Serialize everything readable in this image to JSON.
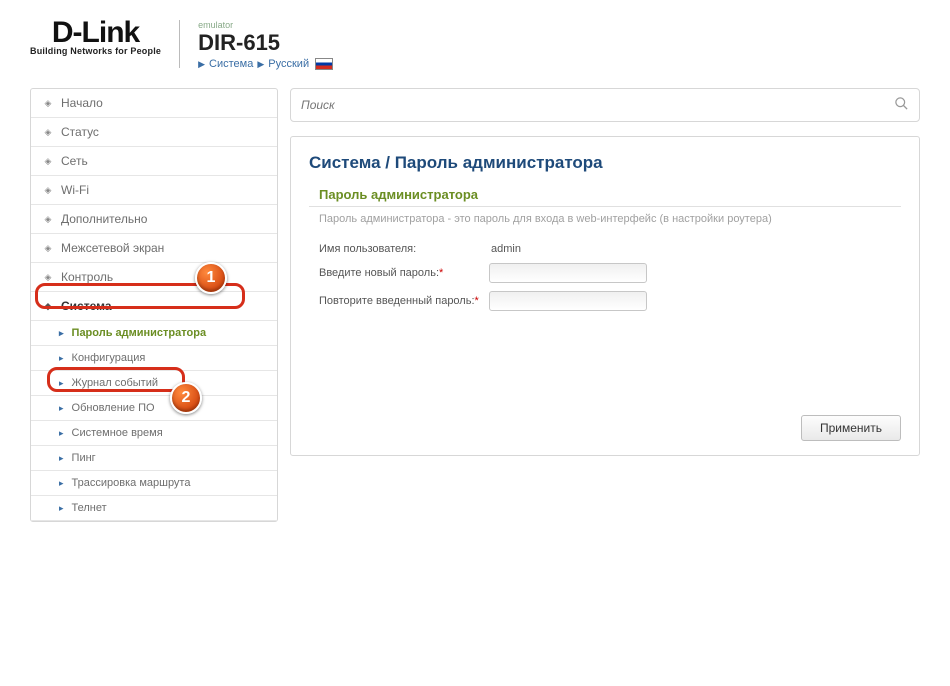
{
  "header": {
    "logo_text": "D-Link",
    "logo_sub": "Building Networks for People",
    "emulator": "emulator",
    "model": "DIR-615",
    "crumb1": "Система",
    "crumb2": "Русский"
  },
  "sidebar": {
    "items": [
      {
        "label": "Начало"
      },
      {
        "label": "Статус"
      },
      {
        "label": "Сеть"
      },
      {
        "label": "Wi-Fi"
      },
      {
        "label": "Дополнительно"
      },
      {
        "label": "Межсетевой экран"
      },
      {
        "label": "Контроль"
      },
      {
        "label": "Система"
      }
    ],
    "sub": [
      {
        "label": "Пароль администратора"
      },
      {
        "label": "Конфигурация"
      },
      {
        "label": "Журнал событий"
      },
      {
        "label": "Обновление ПО"
      },
      {
        "label": "Системное время"
      },
      {
        "label": "Пинг"
      },
      {
        "label": "Трассировка маршрута"
      },
      {
        "label": "Телнет"
      }
    ]
  },
  "search": {
    "placeholder": "Поиск"
  },
  "content": {
    "breadcrumb": "Система /  Пароль администратора",
    "section_title": "Пароль администратора",
    "section_desc": "Пароль администратора - это пароль для входа в web-интерфейс (в настройки роутера)",
    "username_label": "Имя пользователя:",
    "username_value": "admin",
    "newpass_label": "Введите новый пароль:",
    "repeat_label": "Повторите введенный пароль:",
    "apply": "Применить"
  },
  "annotations": {
    "n1": "1",
    "n2": "2"
  }
}
